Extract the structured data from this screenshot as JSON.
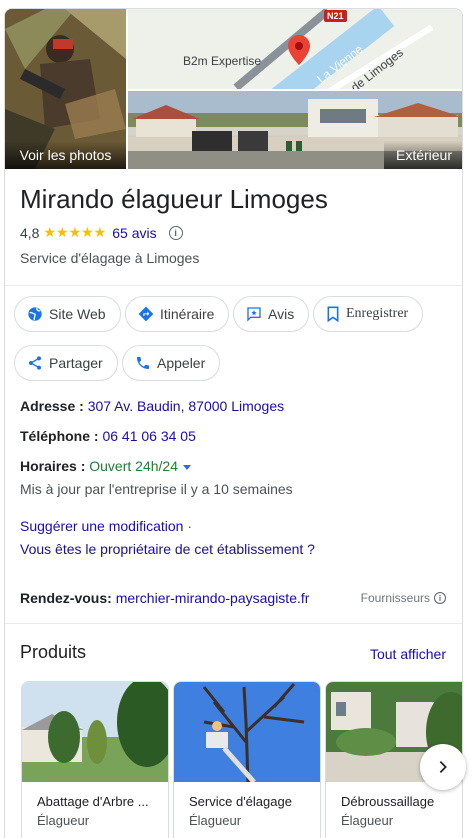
{
  "photos": {
    "main_label": "Voir les photos",
    "exterior_label": "Extérieur",
    "map": {
      "place_label": "B2m Expertise",
      "river_label": "La Vienne",
      "road_label": "de Limoges",
      "shield_label": "N21"
    }
  },
  "business": {
    "name": "Mirando élagueur Limoges",
    "rating": "4,8",
    "stars": "★★★★★",
    "reviews": "65 avis",
    "category": "Service d'élagage à Limoges"
  },
  "actions": {
    "website": "Site Web",
    "directions": "Itinéraire",
    "reviews": "Avis",
    "save": "Enregistrer",
    "share": "Partager",
    "call": "Appeler"
  },
  "details": {
    "address_label": "Adresse :",
    "address_value": "307 Av. Baudin, 87000 Limoges",
    "phone_label": "Téléphone :",
    "phone_value": "06 41 06 34 05",
    "hours_label": "Horaires :",
    "hours_value": "Ouvert 24h/24",
    "hours_updated": "Mis à jour par l'entreprise il y a 10 semaines",
    "suggest_edit": "Suggérer une modification",
    "suggest_sep": "·",
    "owner_link": "Vous êtes le propriétaire de cet établissement ?",
    "appointment_label": "Rendez-vous:",
    "appointment_value": "merchier-mirando-paysagiste.fr",
    "suppliers": "Fournisseurs"
  },
  "products": {
    "heading": "Produits",
    "see_all": "Tout afficher",
    "items": [
      {
        "name": "Abattage d'Arbre ...",
        "sub": "Élagueur"
      },
      {
        "name": "Service d'élagage",
        "sub": "Élagueur"
      },
      {
        "name": "Débroussaillage",
        "sub": "Élagueur"
      }
    ]
  },
  "colors": {
    "link": "#1a0dab",
    "accent": "#1a73e8",
    "open": "#188038",
    "star": "#fbbc04"
  }
}
